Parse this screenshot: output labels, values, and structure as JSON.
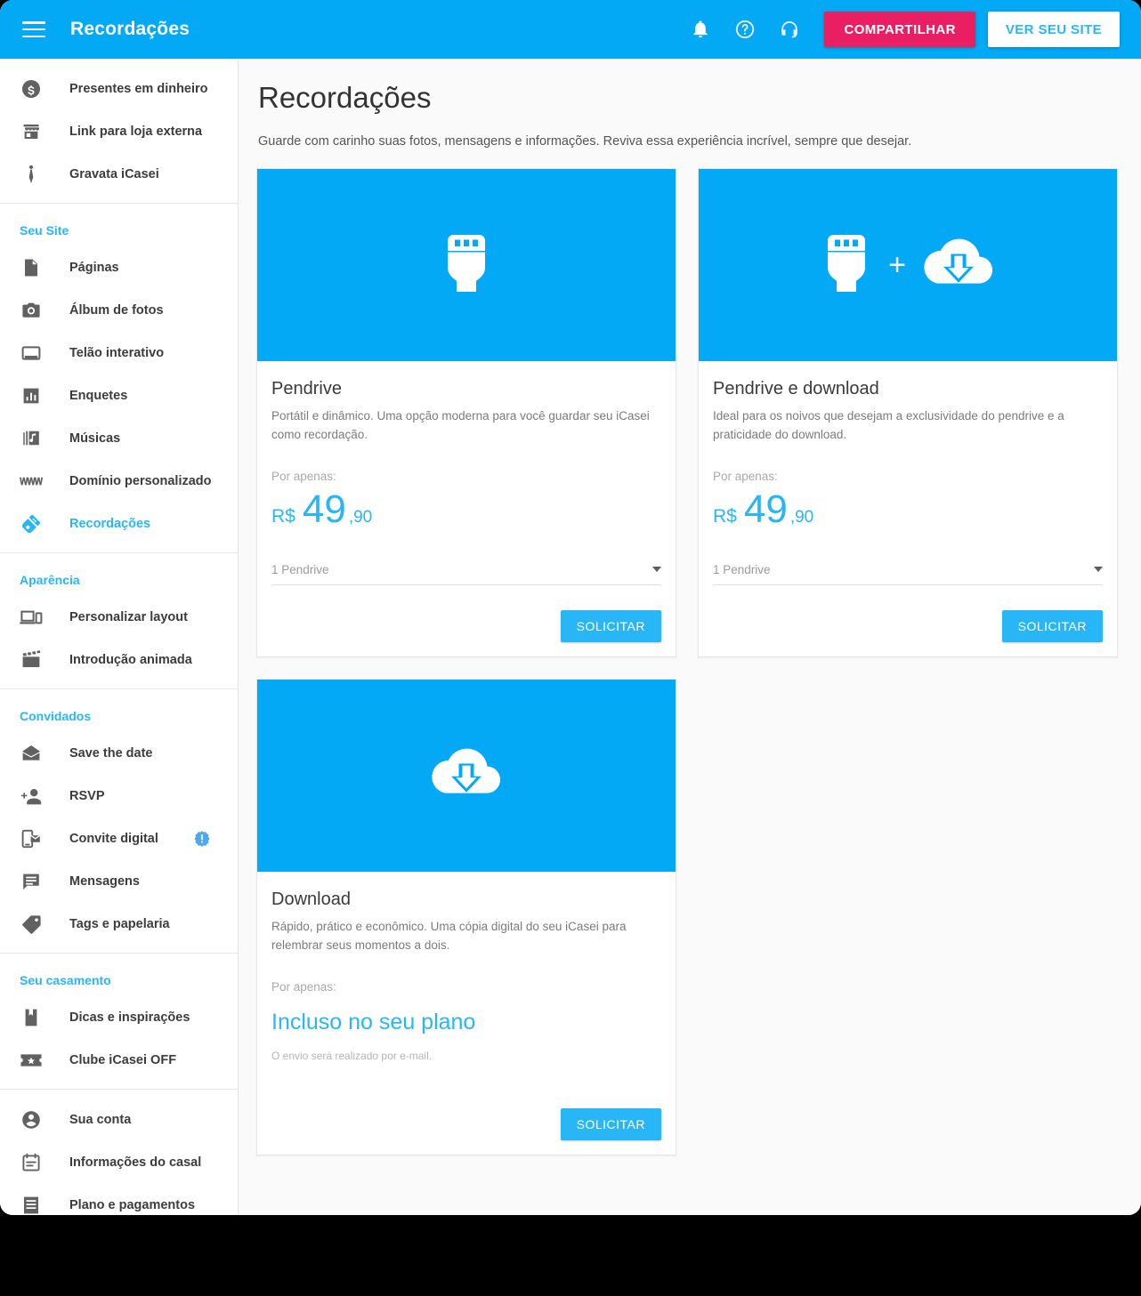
{
  "colors": {
    "brand_blue": "#03a9f4",
    "accent_blue": "#29b6f6",
    "share_pink": "#e91e63",
    "page_bg": "#fafafa"
  },
  "topbar": {
    "menu_icon": "hamburger-icon",
    "title": "Recordações",
    "icons": [
      "bell-icon",
      "help-icon",
      "support-headset-icon"
    ],
    "share_label": "COMPARTILHAR",
    "view_site_label": "VER SEU SITE"
  },
  "sidebar": {
    "sections": [
      {
        "title": null,
        "items": [
          {
            "label": "Presentes em dinheiro",
            "icon": "money-circle-icon",
            "active": false,
            "badge": false
          },
          {
            "label": "Link para loja externa",
            "icon": "store-icon",
            "active": false,
            "badge": false
          },
          {
            "label": "Gravata iCasei",
            "icon": "tie-icon",
            "active": false,
            "badge": false
          }
        ]
      },
      {
        "title": "Seu Site",
        "items": [
          {
            "label": "Páginas",
            "icon": "page-icon",
            "active": false,
            "badge": false
          },
          {
            "label": "Álbum de fotos",
            "icon": "camera-icon",
            "active": false,
            "badge": false
          },
          {
            "label": "Telão interativo",
            "icon": "screen-icon",
            "active": false,
            "badge": false
          },
          {
            "label": "Enquetes",
            "icon": "poll-bars-icon",
            "active": false,
            "badge": false
          },
          {
            "label": "Músicas",
            "icon": "music-library-icon",
            "active": false,
            "badge": false
          },
          {
            "label": "Domínio personalizado",
            "icon": "www-icon",
            "active": false,
            "badge": false
          },
          {
            "label": "Recordações",
            "icon": "usb-drive-icon",
            "active": true,
            "badge": false
          }
        ]
      },
      {
        "title": "Aparência",
        "items": [
          {
            "label": "Personalizar layout",
            "icon": "devices-icon",
            "active": false,
            "badge": false
          },
          {
            "label": "Introdução animada",
            "icon": "clapperboard-icon",
            "active": false,
            "badge": false
          }
        ]
      },
      {
        "title": "Convidados",
        "items": [
          {
            "label": "Save the date",
            "icon": "envelope-open-icon",
            "active": false,
            "badge": false
          },
          {
            "label": "RSVP",
            "icon": "person-add-icon",
            "active": false,
            "badge": false
          },
          {
            "label": "Convite digital",
            "icon": "mobile-invite-icon",
            "active": false,
            "badge": true
          },
          {
            "label": "Mensagens",
            "icon": "chat-lines-icon",
            "active": false,
            "badge": false
          },
          {
            "label": "Tags e papelaria",
            "icon": "tag-icon",
            "active": false,
            "badge": false
          }
        ]
      },
      {
        "title": "Seu casamento",
        "items": [
          {
            "label": "Dicas e inspirações",
            "icon": "book-bookmark-icon",
            "active": false,
            "badge": false
          },
          {
            "label": "Clube iCasei OFF",
            "icon": "ticket-star-icon",
            "active": false,
            "badge": false
          }
        ]
      },
      {
        "title": null,
        "items": [
          {
            "label": "Sua conta",
            "icon": "account-circle-icon",
            "active": false,
            "badge": false
          },
          {
            "label": "Informações do casal",
            "icon": "calendar-note-icon",
            "active": false,
            "badge": false
          },
          {
            "label": "Plano e pagamentos",
            "icon": "receipt-icon",
            "active": false,
            "badge": false
          }
        ]
      }
    ]
  },
  "main": {
    "title": "Recordações",
    "subtitle": "Guarde com carinho suas fotos, mensagens e informações. Reviva essa experiência incrível, sempre que desejar.",
    "cards": [
      {
        "banner_icon": "usb-connector-icon",
        "title": "Pendrive",
        "description": "Portátil e dinâmico. Uma opção moderna para você guardar seu iCasei como recordação.",
        "price_label": "Por apenas:",
        "currency": "R$",
        "price_int": "49",
        "price_dec": ",90",
        "select_value": "1 Pendrive",
        "button_label": "SOLICITAR"
      },
      {
        "banner_icon": "usb-connector-plus-cloud-download-icon",
        "plus": "+",
        "title": "Pendrive e download",
        "description": "Ideal para os noivos que desejam a exclusividade do pendrive e a praticidade do download.",
        "price_label": "Por apenas:",
        "currency": "R$",
        "price_int": "49",
        "price_dec": ",90",
        "select_value": "1 Pendrive",
        "button_label": "SOLICITAR"
      },
      {
        "banner_icon": "cloud-download-icon",
        "title": "Download",
        "description": "Rápido, prático e econômico. Uma cópia digital do seu iCasei para relembrar seus momentos a dois.",
        "price_label": "Por apenas:",
        "included_label": "Incluso no seu plano",
        "note": "O envio será realizado por e-mail.",
        "button_label": "SOLICITAR"
      }
    ]
  }
}
